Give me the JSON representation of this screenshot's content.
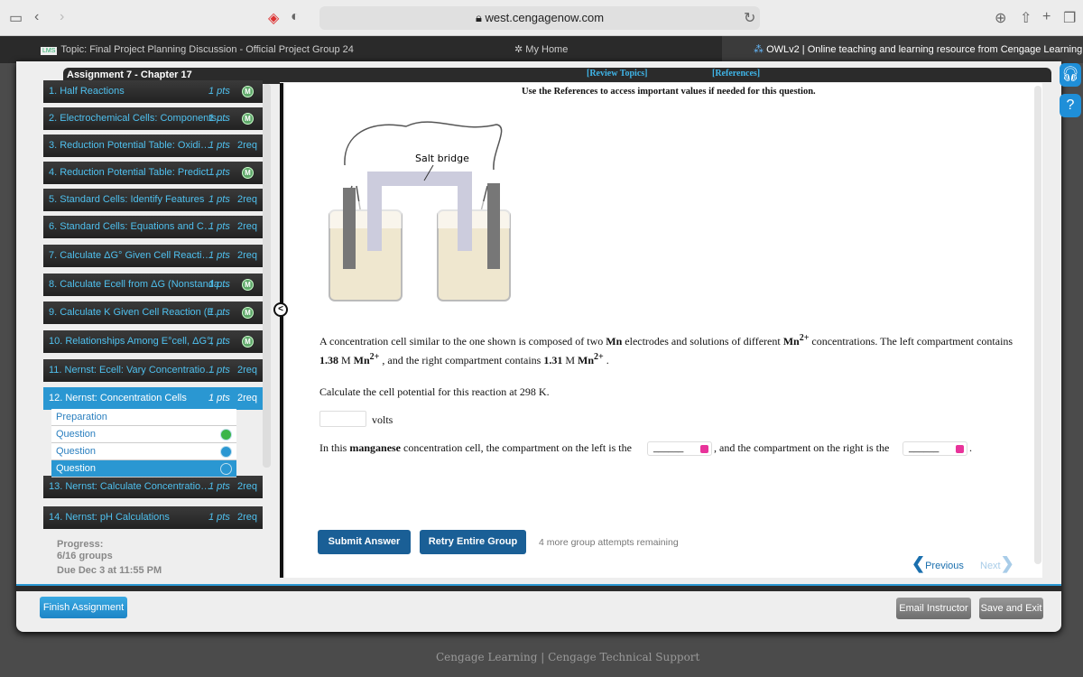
{
  "browser": {
    "url": "west.cengagenow.com"
  },
  "tabs": [
    {
      "label": "Topic: Final Project Planning Discussion - Official Project Group 24"
    },
    {
      "label": "My Home"
    },
    {
      "label": "OWLv2 | Online teaching and learning resource from Cengage Learning"
    }
  ],
  "assignment": {
    "title": "Assignment 7 - Chapter 17",
    "items": [
      {
        "label": "1. Half Reactions",
        "pts": "1 pts",
        "status": "M"
      },
      {
        "label": "2. Electrochemical Cells: Components…",
        "pts": "1 pts",
        "status": "M"
      },
      {
        "label": "3. Reduction Potential Table: Oxidi…",
        "pts": "1 pts",
        "status": "2req"
      },
      {
        "label": "4. Reduction Potential Table: Predict …",
        "pts": "1 pts",
        "status": "M"
      },
      {
        "label": "5. Standard Cells: Identify Features",
        "pts": "1 pts",
        "status": "2req"
      },
      {
        "label": "6. Standard Cells: Equations and C…",
        "pts": "1 pts",
        "status": "2req"
      },
      {
        "label": "7. Calculate ΔG° Given Cell Reacti…",
        "pts": "1 pts",
        "status": "2req"
      },
      {
        "label": "8. Calculate Ecell from ΔG (Nonstanda…",
        "pts": "1 pts",
        "status": "M"
      },
      {
        "label": "9. Calculate K Given Cell Reaction (E…",
        "pts": "1 pts",
        "status": "M"
      },
      {
        "label": "10. Relationships Among E°cell, ΔG°, …",
        "pts": "1 pts",
        "status": "M"
      },
      {
        "label": "11. Nernst: Ecell: Vary Concentratio…",
        "pts": "1 pts",
        "status": "2req"
      },
      {
        "label": "12. Nernst: Concentration Cells",
        "pts": "1 pts",
        "status": "2req"
      },
      {
        "label": "13. Nernst: Calculate Concentratio…",
        "pts": "1 pts",
        "status": "2req"
      },
      {
        "label": "14. Nernst: pH Calculations",
        "pts": "1 pts",
        "status": "2req"
      }
    ],
    "subitems": [
      {
        "label": "Preparation"
      },
      {
        "label": "Question"
      },
      {
        "label": "Question"
      },
      {
        "label": "Question"
      }
    ],
    "progress_label": "Progress:",
    "progress": "6/16 groups",
    "due": "Due Dec 3 at 11:55 PM"
  },
  "content": {
    "review_topics": "[Review Topics]",
    "references": "[References]",
    "note": "Use the References to access important values if needed for this question.",
    "salt_bridge": "Salt bridge",
    "p1a": "A concentration cell similar to the one shown is composed of two ",
    "mn": "Mn",
    "p1b": " electrodes and solutions of different ",
    "mn2": "Mn",
    "sup": "2+",
    "p1c": " concentrations. The left compartment contains ",
    "c1": "1.38",
    "m": " M ",
    "p1d": " , and the right compartment contains ",
    "c2": "1.31",
    "end": " .",
    "q1": "Calculate the cell potential for this reaction at 298 K.",
    "unit": "volts",
    "answer": "",
    "q2a": "In this ",
    "q2b": "manganese",
    "q2c": " concentration cell, the compartment on the left is the ",
    "q2d": ", and the compartment on the right is the ",
    "q2e": ".",
    "blank": "______",
    "submit": "Submit Answer",
    "retry": "Retry Entire Group",
    "attempts": "4 more group attempts remaining",
    "previous": "Previous",
    "next": "Next"
  },
  "footer": {
    "finish": "Finish Assignment",
    "email": "Email Instructor",
    "save": "Save and Exit",
    "cengage": "Cengage Learning",
    "sep": "|",
    "support": "Cengage Technical Support"
  },
  "colors": {
    "accent": "#2a97d2",
    "link": "#4fc0ee",
    "button": "#1a5f96"
  }
}
